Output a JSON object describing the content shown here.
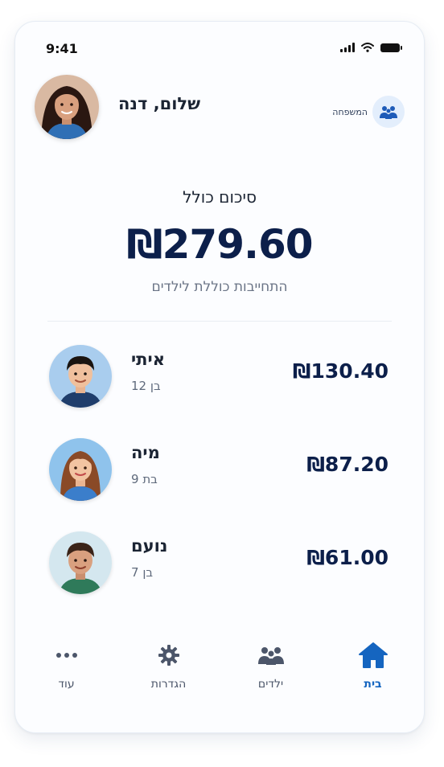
{
  "status_bar": {
    "time": "9:41"
  },
  "header": {
    "greeting": "שלום, דנה",
    "family_label": "המשפחה",
    "family_icon": "family-group-icon"
  },
  "summary": {
    "title": "סיכום כולל",
    "amount": "₪279.60",
    "subtitle": "התחייבות כוללת לילדים"
  },
  "children": [
    {
      "name": "איתי",
      "age": "בן 12",
      "amount": "₪130.40"
    },
    {
      "name": "מיה",
      "age": "בת 9",
      "amount": "₪87.20"
    },
    {
      "name": "נועם",
      "age": "בן 7",
      "amount": "₪61.00"
    }
  ],
  "nav": {
    "home": "בית",
    "children": "ילדים",
    "settings": "הגדרות",
    "more": "עוד",
    "active": "home"
  },
  "colors": {
    "accent": "#1565c0",
    "amount_text": "#0c1f4a",
    "family_icon_bg": "#e3eefc"
  }
}
